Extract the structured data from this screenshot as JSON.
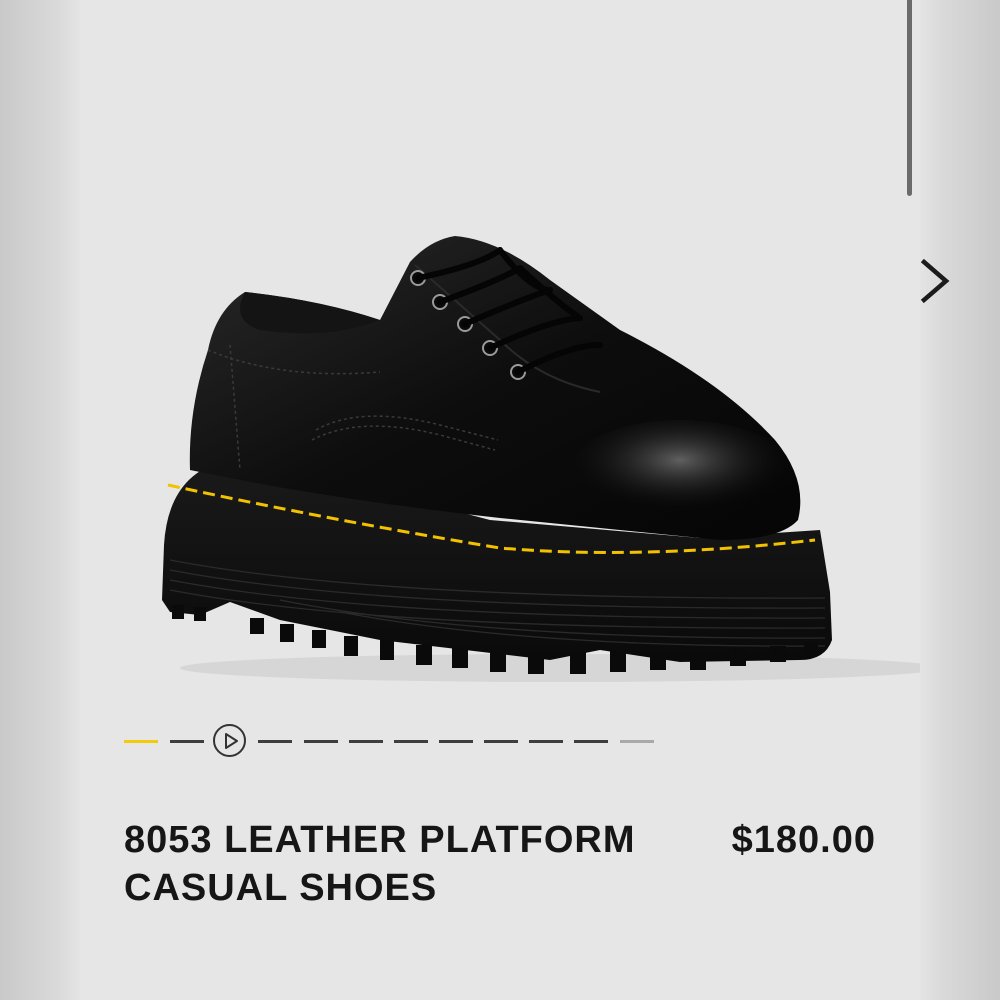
{
  "product": {
    "title": "8053 LEATHER PLATFORM CASUAL SHOES",
    "price": "$180.00",
    "image_alt": "Black leather platform shoe with yellow welt stitching"
  },
  "gallery": {
    "next_icon": "chevron-right-icon",
    "play_icon": "play-icon",
    "active_color": "#f2cc0c",
    "total_slides": 12,
    "active_slide": 1,
    "video_slide": 3
  },
  "colors": {
    "background": "#e6e6e6",
    "text": "#161616",
    "stitching": "#f2c200"
  }
}
